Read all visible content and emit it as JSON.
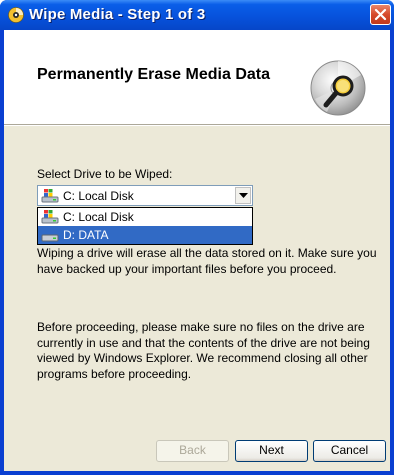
{
  "window": {
    "title": "Wipe Media - Step 1 of 3"
  },
  "header": {
    "title": "Permanently Erase Media Data",
    "icon": "disc-magnifier-icon"
  },
  "drive_select": {
    "label": "Select Drive to be Wiped:",
    "selected_value": "C: Local Disk",
    "options": [
      {
        "label": "C: Local Disk",
        "icon": "windows-drive-icon",
        "highlighted": false
      },
      {
        "label": "D: DATA",
        "icon": "drive-icon",
        "highlighted": true
      }
    ]
  },
  "body": {
    "paragraph1": "Wiping a drive will erase all the data stored on it. Make sure you have backed up your important files before you proceed.",
    "paragraph2": "Before proceeding, please make sure no files on the drive are currently in use and that the contents of the drive are not being viewed by Windows Explorer.  We recommend closing all other programs before proceeding."
  },
  "buttons": {
    "back": "Back",
    "next": "Next",
    "cancel": "Cancel"
  },
  "colors": {
    "titlebar": "#0752dc",
    "selection": "#316ac5",
    "dialog_bg": "#ece9d8"
  }
}
